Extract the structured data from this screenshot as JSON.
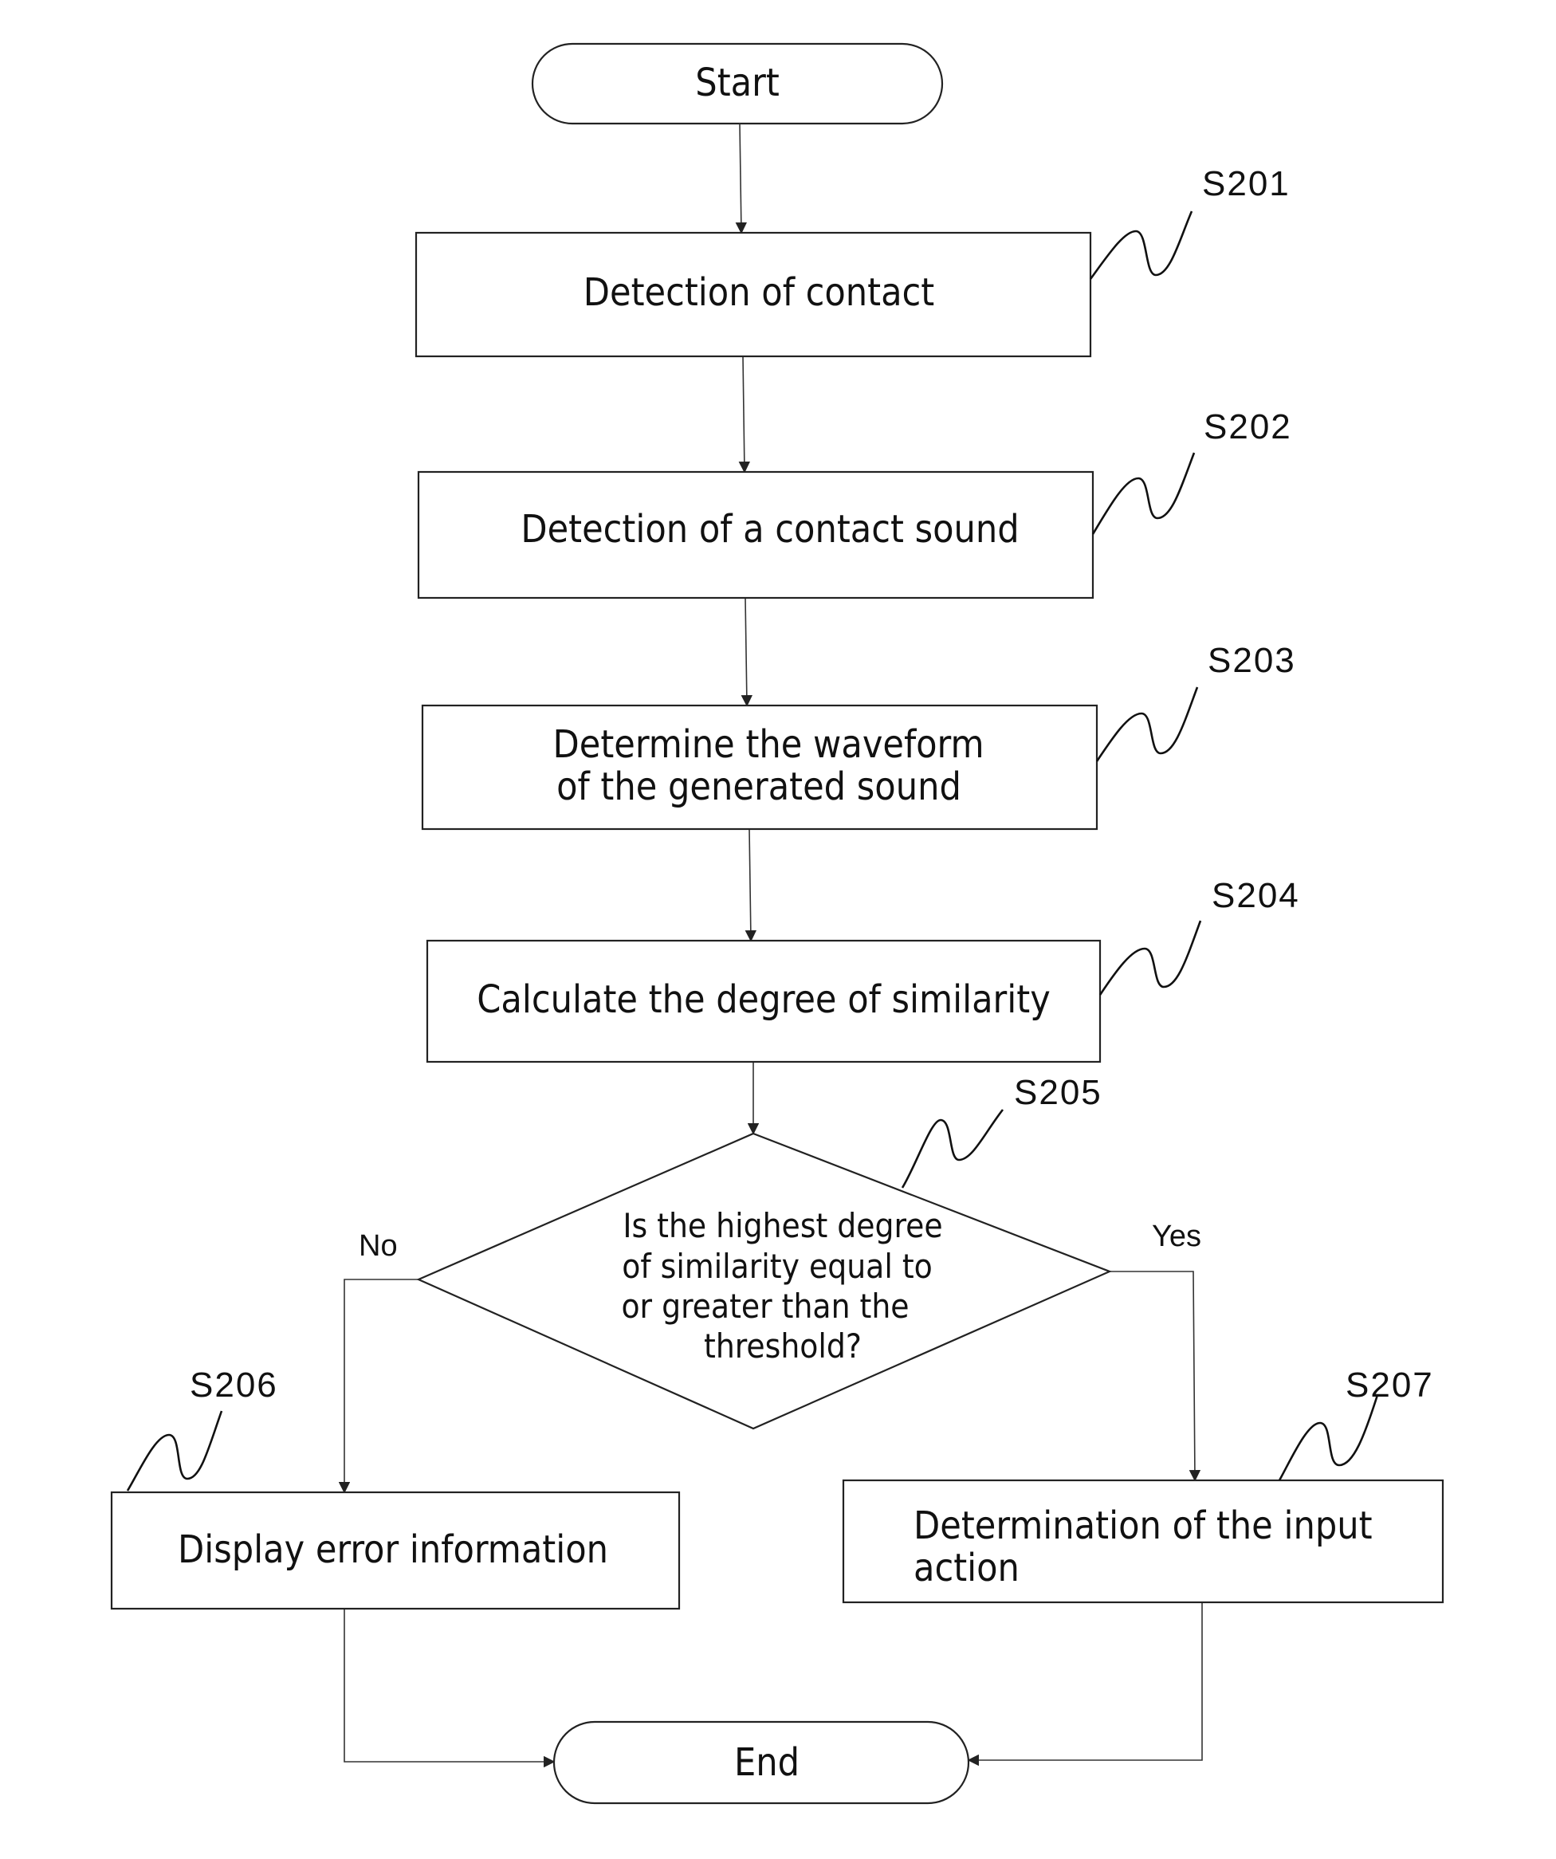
{
  "diagram": {
    "type": "flowchart",
    "start": {
      "label": "Start"
    },
    "end": {
      "label": "End"
    },
    "steps": [
      {
        "id": "S201",
        "lines": [
          "Detection of contact"
        ]
      },
      {
        "id": "S202",
        "lines": [
          "Detection of a contact sound"
        ]
      },
      {
        "id": "S203",
        "lines": [
          "Determine the waveform",
          "of the generated sound"
        ]
      },
      {
        "id": "S204",
        "lines": [
          "Calculate the degree of similarity"
        ]
      }
    ],
    "decision": {
      "id": "S205",
      "lines": [
        "Is the highest degree",
        "of similarity equal to",
        "or greater than the",
        "threshold?"
      ],
      "no_label": "No",
      "yes_label": "Yes"
    },
    "no_branch": {
      "id": "S206",
      "lines": [
        "Display error information"
      ]
    },
    "yes_branch": {
      "id": "S207",
      "lines": [
        "Determination of the input",
        "action"
      ]
    }
  }
}
